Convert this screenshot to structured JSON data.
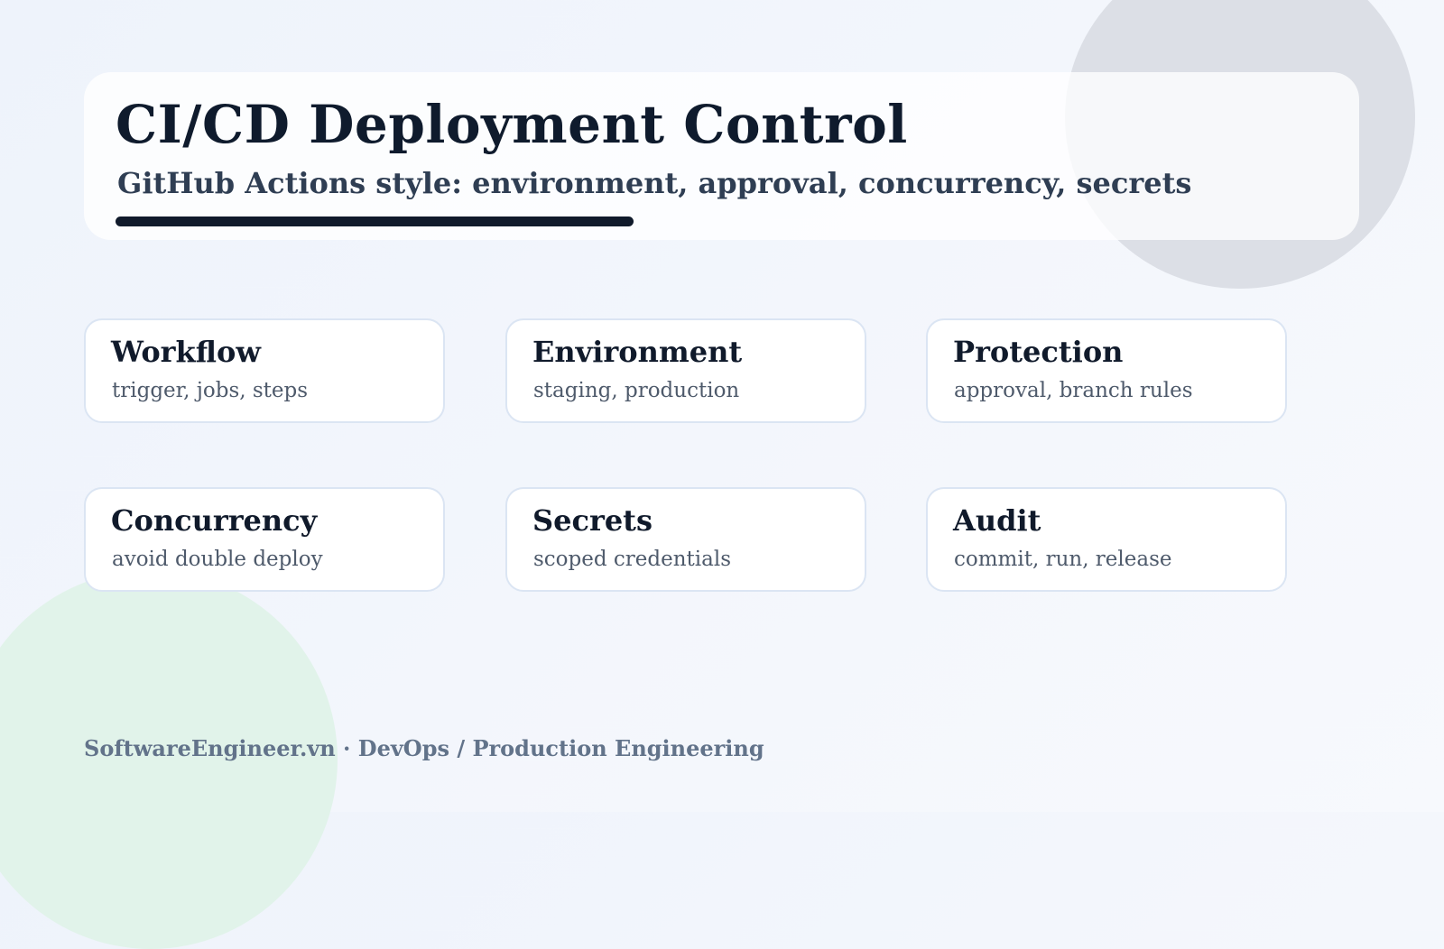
{
  "header": {
    "title": "CI/CD Deployment Control",
    "subtitle": "GitHub Actions style: environment, approval, concurrency, secrets"
  },
  "cards": [
    {
      "title": "Workflow",
      "subtitle": "trigger, jobs, steps"
    },
    {
      "title": "Environment",
      "subtitle": "staging, production"
    },
    {
      "title": "Protection",
      "subtitle": "approval, branch rules"
    },
    {
      "title": "Concurrency",
      "subtitle": "avoid double deploy"
    },
    {
      "title": "Secrets",
      "subtitle": "scoped credentials"
    },
    {
      "title": "Audit",
      "subtitle": "commit, run, release"
    }
  ],
  "footer": {
    "text": "SoftwareEngineer.vn · DevOps / Production Engineering"
  }
}
